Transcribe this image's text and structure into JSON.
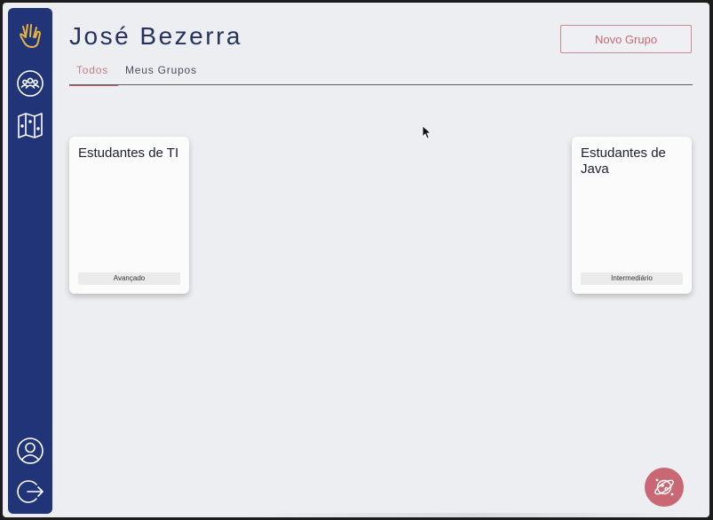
{
  "header": {
    "title": "José Bezerra",
    "new_group_label": "Novo Grupo"
  },
  "tabs": [
    {
      "label": "Todos",
      "active": true
    },
    {
      "label": "Meus Grupos",
      "active": false
    }
  ],
  "sidebar": {
    "items": [
      {
        "icon": "hand-icon",
        "color": "#e8b440"
      },
      {
        "icon": "group-icon",
        "color": "#ffffff"
      },
      {
        "icon": "map-icon",
        "color": "#ffffff"
      }
    ],
    "bottom_items": [
      {
        "icon": "user-icon"
      },
      {
        "icon": "logout-icon"
      }
    ]
  },
  "groups": [
    {
      "name": "Estudantes de TI",
      "level": "Avançado"
    },
    {
      "name": "Estudantes de Java",
      "level": "Intermediário"
    }
  ],
  "fab": {
    "icon": "planet-icon"
  },
  "colors": {
    "sidebar": "#213478",
    "accent": "#c55b68",
    "background": "#eceef1",
    "hand_icon": "#e8b440"
  }
}
